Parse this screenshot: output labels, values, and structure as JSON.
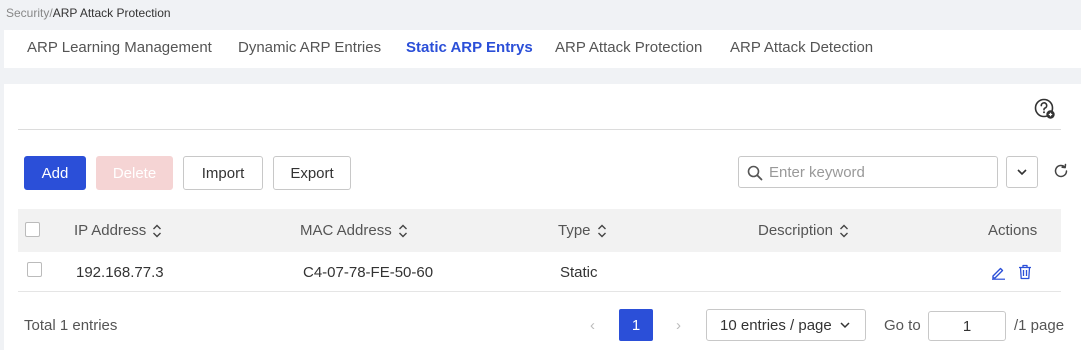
{
  "breadcrumb": {
    "parent": "Security",
    "separator": "/",
    "current": "ARP Attack Protection"
  },
  "tabs": [
    {
      "label": "ARP Learning Management",
      "active": false
    },
    {
      "label": "Dynamic ARP Entries",
      "active": false
    },
    {
      "label": "Static ARP Entrys",
      "active": true
    },
    {
      "label": "ARP Attack Protection",
      "active": false
    },
    {
      "label": "ARP Attack Detection",
      "active": false
    }
  ],
  "toolbar": {
    "add_label": "Add",
    "delete_label": "Delete",
    "import_label": "Import",
    "export_label": "Export",
    "search_placeholder": "Enter keyword"
  },
  "table": {
    "columns": [
      "IP Address",
      "MAC Address",
      "Type",
      "Description",
      "Actions"
    ],
    "rows": [
      {
        "ip": "192.168.77.3",
        "mac": "C4-07-78-FE-50-60",
        "type": "Static",
        "description": ""
      }
    ]
  },
  "pagination": {
    "total_text": "Total 1 entries",
    "prev": "‹",
    "next": "›",
    "current_page": "1",
    "per_page": "10 entries / page",
    "goto_label": "Go to",
    "goto_value": "1",
    "page_suffix": "/1 page"
  },
  "colors": {
    "primary": "#2b4fd8",
    "disabled": "#f5d4d4"
  }
}
